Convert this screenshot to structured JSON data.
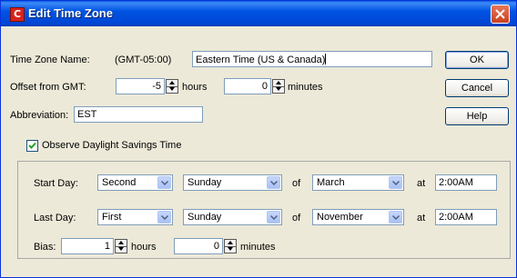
{
  "window": {
    "title": "Edit Time Zone",
    "app_icon_letter": "C"
  },
  "time_zone_name": {
    "label": "Time Zone Name:",
    "gmt_prefix": "(GMT-05:00)",
    "value": "Eastern Time (US & Canada)"
  },
  "offset": {
    "label": "Offset from GMT:",
    "hours_value": "-5",
    "hours_label": "hours",
    "minutes_value": "0",
    "minutes_label": "minutes"
  },
  "abbreviation": {
    "label": "Abbreviation:",
    "value": "EST"
  },
  "buttons": {
    "ok": "OK",
    "cancel": "Cancel",
    "help": "Help"
  },
  "dst": {
    "checkbox_label": "Observe Daylight Savings Time",
    "checked": true,
    "start": {
      "label": "Start Day:",
      "week": "Second",
      "weekday": "Sunday",
      "of_label": "of",
      "month": "March",
      "at_label": "at",
      "time": "2:00AM"
    },
    "last": {
      "label": "Last Day:",
      "week": "First",
      "weekday": "Sunday",
      "of_label": "of",
      "month": "November",
      "at_label": "at",
      "time": "2:00AM"
    },
    "bias": {
      "label": "Bias:",
      "hours_value": "1",
      "hours_label": "hours",
      "minutes_value": "0",
      "minutes_label": "minutes"
    }
  },
  "colors": {
    "titlebar": "#0054e3",
    "close": "#c8401f",
    "dialog_bg": "#ece9d8"
  },
  "icons": [
    "app-icon",
    "close-icon",
    "spin-up-icon",
    "spin-down-icon",
    "checkmark-icon",
    "dropdown-arrow-icon"
  ]
}
